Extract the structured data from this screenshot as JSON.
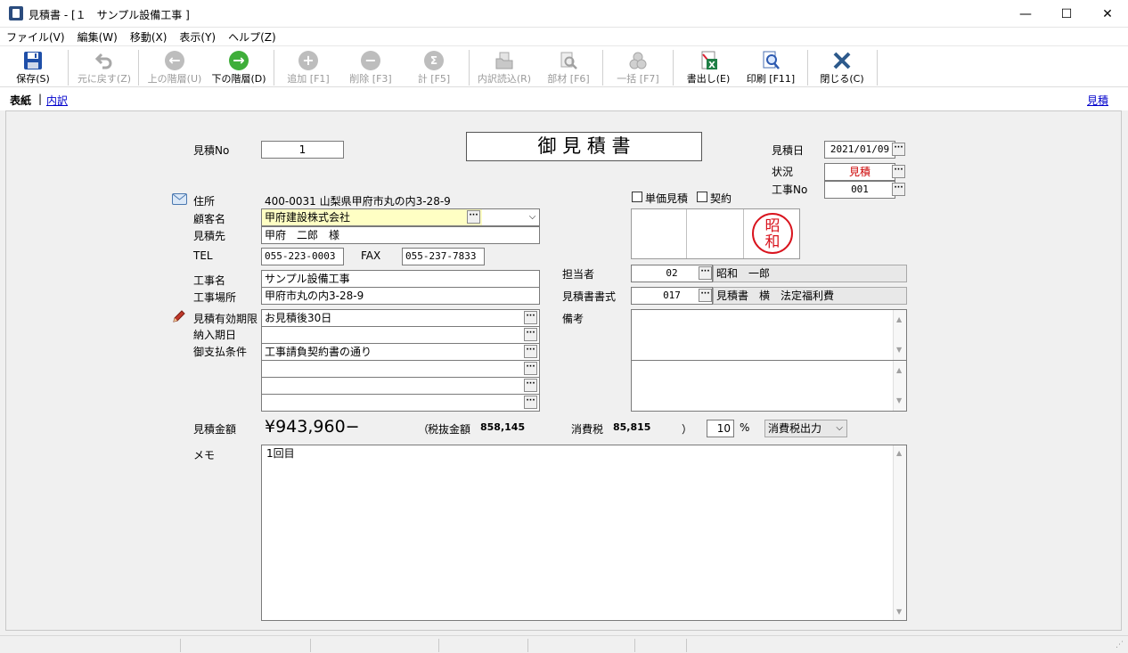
{
  "window": {
    "title": "見積書 - [１　サンプル設備工事 ]",
    "controls": [
      "—",
      "☐",
      "✕"
    ]
  },
  "menu": [
    "ファイル(V)",
    "編集(W)",
    "移動(X)",
    "表示(Y)",
    "ヘルプ(Z)"
  ],
  "toolbar": {
    "save": "保存(S)",
    "undo": "元に戻す(Z)",
    "up_level": "上の階層(U)",
    "down_level": "下の階層(D)",
    "add": "追加 [F1]",
    "delete": "削除 [F3]",
    "sum": "計 [F5]",
    "import_detail": "内訳読込(R)",
    "parts": "部材 [F6]",
    "bulk": "一括 [F7]",
    "export": "書出し(E)",
    "print": "印刷 [F11]",
    "close": "閉じる(C)"
  },
  "tabs": {
    "cover": "表紙",
    "separator": "|",
    "detail": "内訳",
    "right_link": "見積"
  },
  "form": {
    "doc_title": "御 見 積 書",
    "estimate_no_label": "見積No",
    "estimate_no": "1",
    "estimate_date_label": "見積日",
    "estimate_date": "2021/01/09",
    "status_label": "状況",
    "status": "見積",
    "project_no_label": "工事No",
    "project_no": "001",
    "address_label": "住所",
    "address": "400-0031 山梨県甲府市丸の内3-28-9",
    "customer_label": "顧客名",
    "customer": "甲府建設株式会社",
    "recipient_label": "見積先",
    "recipient": "甲府　二郎　様",
    "unit_price_label": "単価見積",
    "contract_label": "契約",
    "stamp_text": "昭和",
    "tel_label": "TEL",
    "tel": "055-223-0003",
    "fax_label": "FAX",
    "fax": "055-237-7833",
    "project_name_label": "工事名",
    "project_name": "サンプル設備工事",
    "project_site_label": "工事場所",
    "project_site": "甲府市丸の内3-28-9",
    "staff_label": "担当者",
    "staff_code": "02",
    "staff_name": "昭和　一郎",
    "format_label": "見積書書式",
    "format_code": "017",
    "format_name": "見積書　横　法定福利費",
    "validity_label": "見積有効期限",
    "validity": "お見積後30日",
    "delivery_label": "納入期日",
    "delivery": "",
    "payment_label": "御支払条件",
    "payment": "工事請負契約書の通り",
    "remarks_label": "備考",
    "amount_label": "見積金額",
    "amount": "¥943,960−",
    "pretax_open": "（",
    "pretax_label": "税抜金額",
    "pretax": "858,145",
    "tax_label": "消費税",
    "tax": "85,815",
    "pretax_close": "）",
    "tax_rate": "10",
    "percent": "%",
    "tax_mode": "消費税出力",
    "memo_label": "メモ",
    "memo": "1回目"
  },
  "colors": {
    "highlight_field": "#ffffc4",
    "status_red": "#cc0000",
    "stamp_red": "#d9141e",
    "link_blue": "#0000cc"
  }
}
